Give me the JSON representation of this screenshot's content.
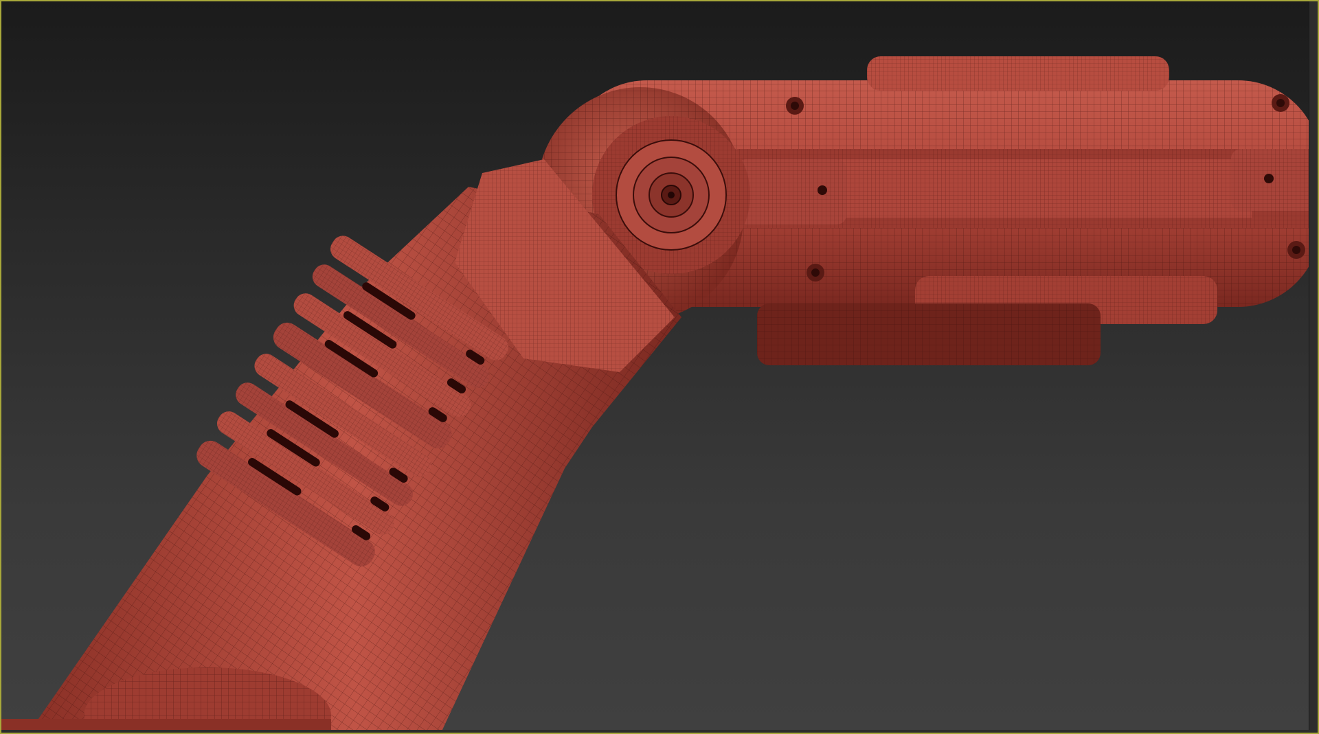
{
  "viewport": {
    "label": "",
    "border_color": "#a8a83a",
    "background_top": "#1b1b1b",
    "background_bottom": "#404040"
  },
  "model": {
    "base_color": "#b0463a",
    "wire_color": "#3a0d0a",
    "highlight_color": "#d9776a",
    "shadow_color": "#5e1a14",
    "display_mode": "shaded-wireframe"
  }
}
